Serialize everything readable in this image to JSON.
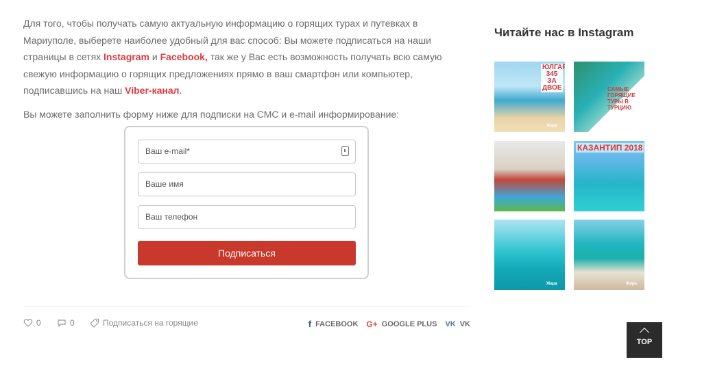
{
  "article": {
    "p1_a": "Для того, чтобы получать самую актуальную информацию о горящих турах и путевках в Мариуполе, выберете наиболее удобный для вас способ: Вы можете подписаться на наши страницы в сетях ",
    "link_instagram": "Instagram",
    "p1_b": " и ",
    "link_facebook": "Facebook,",
    "p1_c": " так же у Вас есть возможность получать всю самую свежую информацию о горящих предложениях прямо в ваш смартфон или компьютер, подписавшись на наш ",
    "link_viber": "Viber-канал",
    "p1_d": ".",
    "p2": "Вы можете заполнить форму ниже для подписки на СМС и e-mail информирование:"
  },
  "form": {
    "email_placeholder": "Ваш e-mail*",
    "name_placeholder": "Ваше имя",
    "phone_placeholder": "Ваш телефон",
    "submit_label": "Подписаться"
  },
  "meta": {
    "likes": "0",
    "comments": "0",
    "subscribe_label": "Подписаться на горящие"
  },
  "share": {
    "facebook": "FACEBOOK",
    "google": "GOOGLE PLUS",
    "vk": "VK"
  },
  "sidebar": {
    "title": "Читайте нас в Instagram",
    "tile1_text": "ЮЛГАР 345 ЗА ДВОЕ",
    "tile2_text": "САМЫЕ ГОРЯЩИЕ ТУРЫ В ТУРЦИЮ",
    "tile4_text": "КАЗАНТИП 2018",
    "badge": "Жара"
  },
  "top_button": {
    "label": "TOP"
  },
  "colors": {
    "accent": "#c8392b",
    "link": "#e0393e",
    "fb": "#3b5998",
    "gplus": "#dd4b39",
    "vk": "#4c75a3"
  }
}
